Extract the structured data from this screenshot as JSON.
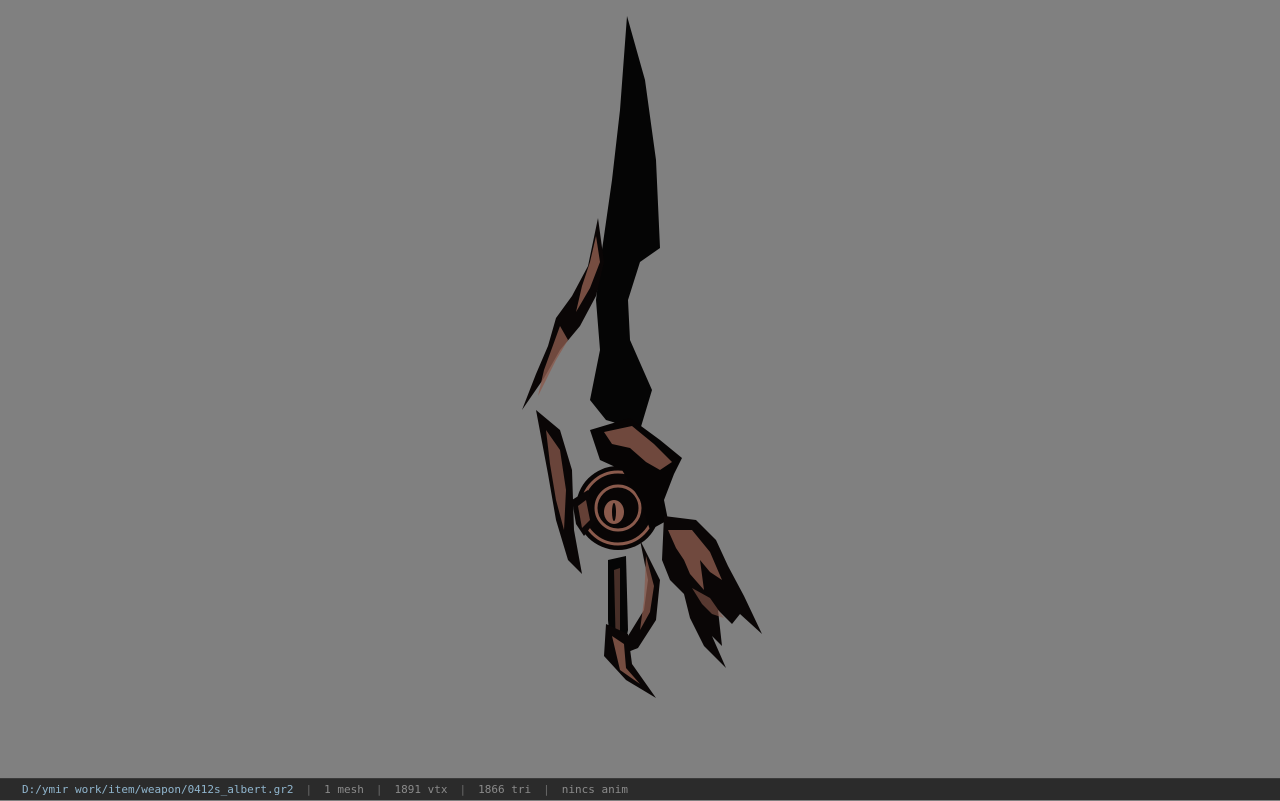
{
  "viewport": {
    "background_color": "#808080",
    "model_icon": "sword-model",
    "model_colors": {
      "blade": "#050505",
      "trim": "#8a5a4c"
    }
  },
  "statusbar": {
    "file_path": "D:/ymir work/item/weapon/0412s_albert.gr2",
    "mesh_count": "1 mesh",
    "vertex_count": "1891 vtx",
    "triangle_count": "1866 tri",
    "animation": "nincs anim",
    "separator": "|"
  }
}
